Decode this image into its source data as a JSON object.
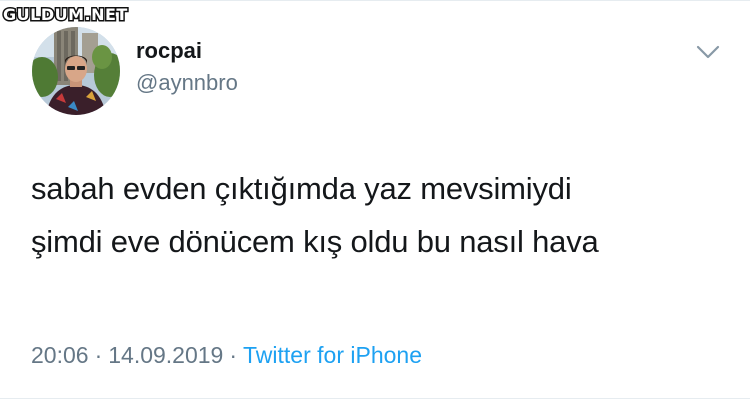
{
  "watermark": {
    "text": "GULDUM.NET"
  },
  "user": {
    "display_name": "rocpai",
    "handle": "@aynnbro"
  },
  "tweet": {
    "lines": [
      "sabah evden çıktığımda yaz mevsimiydi",
      "şimdi eve dönücem kış oldu bu nasıl hava"
    ]
  },
  "meta": {
    "time": "20:06",
    "separator": "·",
    "date": "14.09.2019",
    "source": "Twitter for iPhone"
  },
  "colors": {
    "text": "#14171a",
    "secondary": "#657786",
    "link": "#1da1f2",
    "divider": "#e6ecf0"
  },
  "icons": {
    "caret": "chevron-down-icon"
  }
}
